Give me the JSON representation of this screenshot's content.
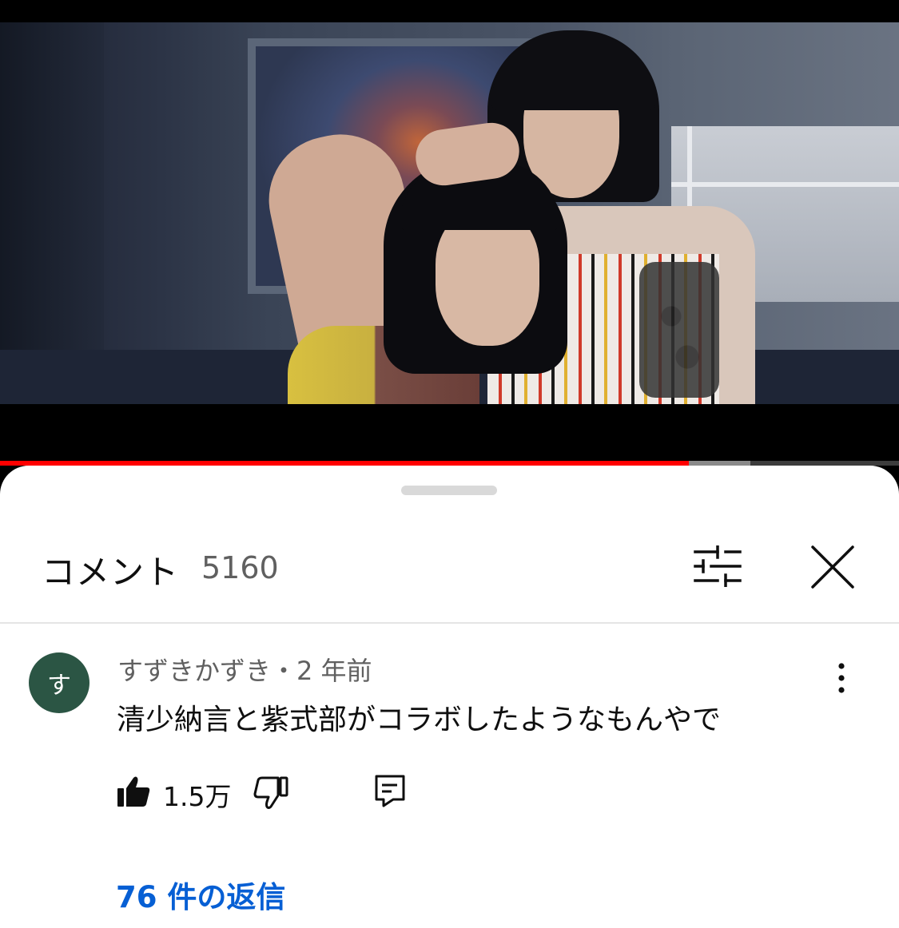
{
  "video": {
    "progress_played": 0.766,
    "progress_buffered": 0.835,
    "colors": {
      "played": "#ff0000",
      "buffered": "#8a8a8a",
      "track": "#3d3d3d"
    }
  },
  "comments_panel": {
    "title": "コメント",
    "count": "5160",
    "icons": {
      "filter": "filter-sliders-icon",
      "close": "close-icon"
    }
  },
  "comment": {
    "avatar_initial": "す",
    "avatar_color": "#2b5544",
    "author_time": "すずきかずき・2 年前",
    "text": "清少納言と紫式部がコラボしたようなもんやで",
    "likes": "1.5万",
    "icons": {
      "like": "thumbs-up-icon",
      "dislike": "thumbs-down-icon",
      "reply": "reply-icon",
      "more": "more-vertical-icon"
    },
    "replies_label": "76 件の返信",
    "replies_color": "#065fd4"
  }
}
